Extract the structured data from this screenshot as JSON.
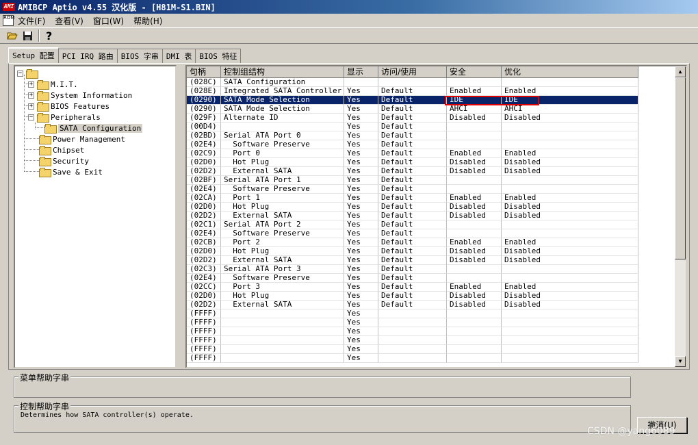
{
  "window": {
    "logo_text": "AMI",
    "title": "AMIBCP Aptio v4.55  汉化版 - [H81M-S1.BIN]"
  },
  "menubar": {
    "app_icon": "ROM",
    "items": [
      "文件(F)",
      "查看(V)",
      "窗口(W)",
      "帮助(H)"
    ]
  },
  "toolbar": {
    "buttons": [
      "open-folder-icon",
      "save-icon",
      "help-icon"
    ]
  },
  "tabs": [
    "Setup 配置",
    "PCI IRQ 路由",
    "BIOS 字串",
    "DMI 表",
    "BIOS 特征"
  ],
  "tree": {
    "items": [
      {
        "label": ""
      },
      {
        "label": "M.I.T."
      },
      {
        "label": "System Information"
      },
      {
        "label": "BIOS Features"
      },
      {
        "label": "Peripherals"
      },
      {
        "label": "SATA Configuration"
      },
      {
        "label": "Power Management"
      },
      {
        "label": "Chipset"
      },
      {
        "label": "Security"
      },
      {
        "label": "Save & Exit"
      }
    ]
  },
  "grid": {
    "columns": [
      "句柄",
      "控制组结构",
      "显示",
      "访问/使用",
      "安全",
      "优化"
    ],
    "rows": [
      [
        "(028C)",
        "SATA Configuration",
        "",
        "",
        "",
        ""
      ],
      [
        "(028E)",
        "Integrated SATA Controller",
        "Yes",
        "Default",
        "Enabled",
        "Enabled"
      ],
      [
        "(0290)",
        "SATA Mode Selection",
        "Yes",
        "Default",
        "IDE",
        "IDE"
      ],
      [
        "(0290)",
        "SATA Mode Selection",
        "Yes",
        "Default",
        "AHCI",
        "AHCI"
      ],
      [
        "(029F)",
        "Alternate ID",
        "Yes",
        "Default",
        "Disabled",
        "Disabled"
      ],
      [
        "(00D4)",
        "",
        "Yes",
        "Default",
        "",
        ""
      ],
      [
        "(02BD)",
        "Serial ATA Port 0",
        "Yes",
        "Default",
        "",
        ""
      ],
      [
        "(02E4)",
        "  Software Preserve",
        "Yes",
        "Default",
        "",
        ""
      ],
      [
        "(02C9)",
        "  Port 0",
        "Yes",
        "Default",
        "Enabled",
        "Enabled"
      ],
      [
        "(02D0)",
        "  Hot Plug",
        "Yes",
        "Default",
        "Disabled",
        "Disabled"
      ],
      [
        "(02D2)",
        "  External SATA",
        "Yes",
        "Default",
        "Disabled",
        "Disabled"
      ],
      [
        "(02BF)",
        "Serial ATA Port 1",
        "Yes",
        "Default",
        "",
        ""
      ],
      [
        "(02E4)",
        "  Software Preserve",
        "Yes",
        "Default",
        "",
        ""
      ],
      [
        "(02CA)",
        "  Port 1",
        "Yes",
        "Default",
        "Enabled",
        "Enabled"
      ],
      [
        "(02D0)",
        "  Hot Plug",
        "Yes",
        "Default",
        "Disabled",
        "Disabled"
      ],
      [
        "(02D2)",
        "  External SATA",
        "Yes",
        "Default",
        "Disabled",
        "Disabled"
      ],
      [
        "(02C1)",
        "Serial ATA Port 2",
        "Yes",
        "Default",
        "",
        ""
      ],
      [
        "(02E4)",
        "  Software Preserve",
        "Yes",
        "Default",
        "",
        ""
      ],
      [
        "(02CB)",
        "  Port 2",
        "Yes",
        "Default",
        "Enabled",
        "Enabled"
      ],
      [
        "(02D0)",
        "  Hot Plug",
        "Yes",
        "Default",
        "Disabled",
        "Disabled"
      ],
      [
        "(02D2)",
        "  External SATA",
        "Yes",
        "Default",
        "Disabled",
        "Disabled"
      ],
      [
        "(02C3)",
        "Serial ATA Port 3",
        "Yes",
        "Default",
        "",
        ""
      ],
      [
        "(02E4)",
        "  Software Preserve",
        "Yes",
        "Default",
        "",
        ""
      ],
      [
        "(02CC)",
        "  Port 3",
        "Yes",
        "Default",
        "Enabled",
        "Enabled"
      ],
      [
        "(02D0)",
        "  Hot Plug",
        "Yes",
        "Default",
        "Disabled",
        "Disabled"
      ],
      [
        "(02D2)",
        "  External SATA",
        "Yes",
        "Default",
        "Disabled",
        "Disabled"
      ],
      [
        "(FFFF)",
        "",
        "Yes",
        "",
        "",
        ""
      ],
      [
        "(FFFF)",
        "",
        "Yes",
        "",
        "",
        ""
      ],
      [
        "(FFFF)",
        "",
        "Yes",
        "",
        "",
        ""
      ],
      [
        "(FFFF)",
        "",
        "Yes",
        "",
        "",
        ""
      ],
      [
        "(FFFF)",
        "",
        "Yes",
        "",
        "",
        ""
      ],
      [
        "(FFFF)",
        "",
        "Yes",
        "",
        "",
        ""
      ]
    ],
    "selected_row": 2
  },
  "menu_help": {
    "title": "菜单帮助字串",
    "text": ""
  },
  "control_help": {
    "title": "控制帮助字串",
    "text": "Determines how SATA controller(s) operate."
  },
  "cancel_button": "撤消(U)",
  "watermark": "CSDN @yang6089",
  "colors": {
    "selection": "#0a246a",
    "highlight_box": "#e00000",
    "chrome": "#d4d0c8"
  }
}
